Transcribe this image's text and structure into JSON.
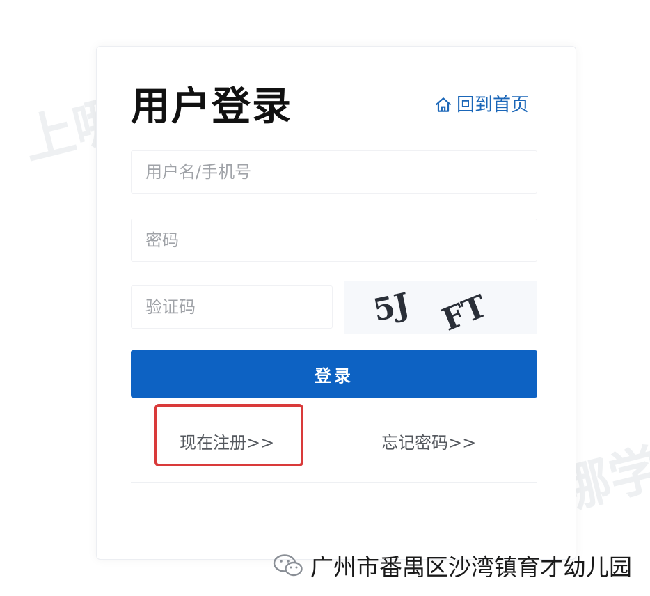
{
  "page": {
    "title": "用户登录",
    "home_link": "回到首页"
  },
  "form": {
    "username_placeholder": "用户名/手机号",
    "password_placeholder": "密码",
    "captcha_placeholder": "验证码",
    "captcha_text": "5J",
    "captcha_text_2": "FT",
    "login_button": "登录",
    "register_link": "现在注册>>",
    "forgot_link": "忘记密码>>"
  },
  "watermark": {
    "text": "上哪学"
  },
  "footer": {
    "credit": "广州市番禺区沙湾镇育才幼儿园"
  },
  "colors": {
    "primary": "#0d62c3",
    "link": "#1a66b8",
    "highlight_border": "#d93a3a"
  },
  "icons": {
    "home": "home-icon",
    "wechat": "wechat-icon"
  }
}
